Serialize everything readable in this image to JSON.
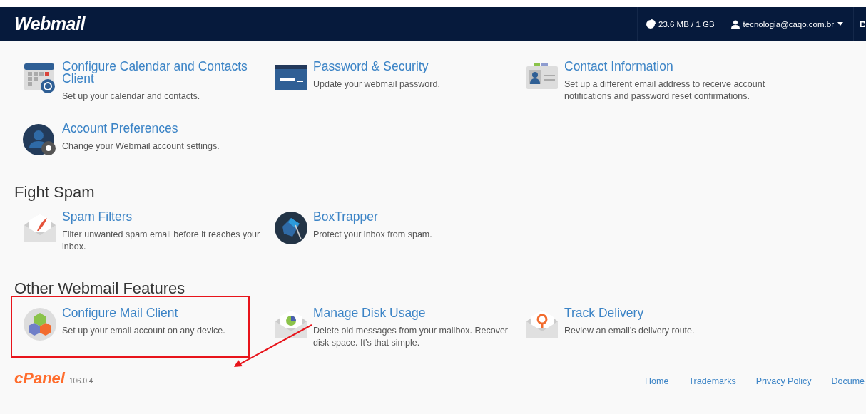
{
  "navbar": {
    "logo": "Webmail",
    "disk_usage": "23.6 MB / 1 GB",
    "user": "tecnologia@caqo.com.br"
  },
  "sections": [
    {
      "items": [
        {
          "title": "Configure Calendar and Contacts Client",
          "description": "Set up your calendar and contacts."
        },
        {
          "title": "Password & Security",
          "description": "Update your webmail password."
        },
        {
          "title": "Contact Information",
          "description": "Set up a different email address to receive account notifications and password reset confirmations."
        },
        {
          "title": "Account Preferences",
          "description": "Change your Webmail account settings."
        }
      ]
    },
    {
      "title": "Fight Spam",
      "items": [
        {
          "title": "Spam Filters",
          "description": "Filter unwanted spam email before it reaches your inbox."
        },
        {
          "title": "BoxTrapper",
          "description": "Protect your inbox from spam."
        }
      ]
    },
    {
      "title": "Other Webmail Features",
      "items": [
        {
          "title": "Configure Mail Client",
          "description": "Set up your email account on any device.",
          "highlighted": true
        },
        {
          "title": "Manage Disk Usage",
          "description": "Delete old messages from your mailbox. Recover disk space. It’s that simple.",
          "highlighted": false
        },
        {
          "title": "Track Delivery",
          "description": "Review an email’s delivery route.",
          "highlighted": false
        }
      ]
    }
  ],
  "footer": {
    "logo": "cPanel",
    "version": "106.0.4",
    "links": [
      "Home",
      "Trademarks",
      "Privacy Policy",
      "Docume"
    ]
  }
}
